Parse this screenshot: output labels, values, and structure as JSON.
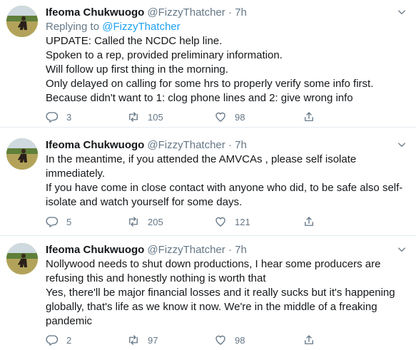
{
  "tweets": [
    {
      "name": "Ifeoma Chukwuogo",
      "handle": "@FizzyThatcher",
      "separator": "·",
      "time": "7h",
      "replying_prefix": "Replying to",
      "replying_to": "@FizzyThatcher",
      "lines": [
        "UPDATE: Called the NCDC help line.",
        "Spoken to a rep, provided preliminary information.",
        "Will follow up first thing in the morning.",
        "Only delayed on calling for some hrs to properly verify some info first.",
        "Because didn't want to 1: clog phone lines and 2: give wrong info"
      ],
      "replies": "3",
      "retweets": "105",
      "likes": "98"
    },
    {
      "name": "Ifeoma Chukwuogo",
      "handle": "@FizzyThatcher",
      "separator": "·",
      "time": "7h",
      "lines": [
        "In the meantime, if you attended the AMVCAs , please self isolate",
        "immediately.",
        "If you have come in close contact with anyone who did, to be safe also self-",
        "isolate and watch yourself for some days."
      ],
      "replies": "5",
      "retweets": "205",
      "likes": "121"
    },
    {
      "name": "Ifeoma Chukwuogo",
      "handle": "@FizzyThatcher",
      "separator": "·",
      "time": "7h",
      "lines": [
        "Nollywood needs to shut down productions, I hear some producers  are",
        "refusing this and honestly nothing is worth that",
        "Yes, there'll be major financial losses and it really sucks but it's happening",
        "globally, that's life as we know it now. We're in the middle of a freaking",
        "pandemic"
      ],
      "replies": "2",
      "retweets": "97",
      "likes": "98"
    }
  ],
  "icons": {
    "reply": "reply-icon",
    "retweet": "retweet-icon",
    "like": "heart-icon",
    "share": "share-icon",
    "more": "chevron-down-icon"
  },
  "colors": {
    "text": "#14171a",
    "muted": "#657786",
    "link": "#1da1f2",
    "divider": "#e6ecf0"
  }
}
